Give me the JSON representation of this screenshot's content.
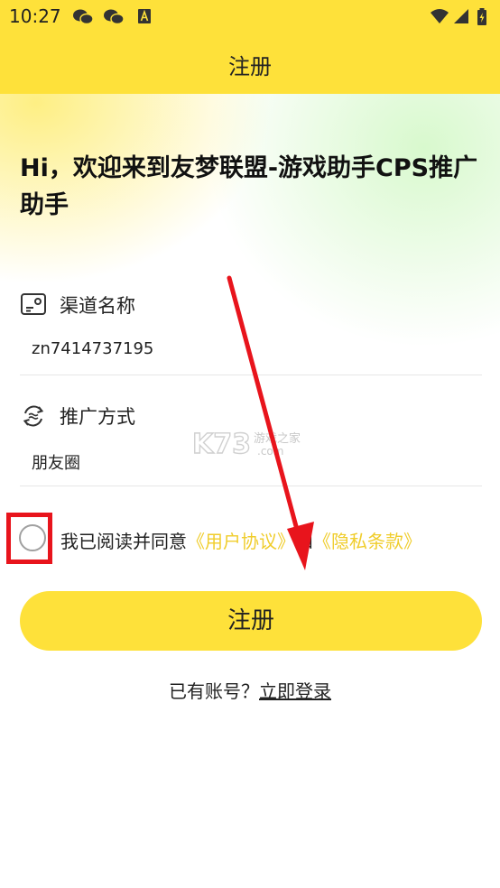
{
  "status_bar": {
    "time": "10:27",
    "left_icons": [
      "wechat-icon",
      "wechat-icon",
      "app-a-icon"
    ],
    "right_icons": [
      "wifi-icon",
      "signal-icon",
      "battery-charging-icon"
    ]
  },
  "header": {
    "title": "注册"
  },
  "welcome": {
    "text": "Hi，欢迎来到友梦联盟-游戏助手CPS推广助手"
  },
  "form": {
    "channel": {
      "label": "渠道名称",
      "value": "zn7414737195",
      "icon": "id-card-icon"
    },
    "method": {
      "label": "推广方式",
      "value": "朋友圈",
      "icon": "refresh-icon"
    }
  },
  "agreement": {
    "prefix": "我已阅读并同意",
    "user_agreement": "《用户协议》",
    "and": "和",
    "privacy": "《隐私条款》"
  },
  "register_button": {
    "label": "注册"
  },
  "login": {
    "prompt": "已有账号？",
    "link": "立即登录"
  },
  "colors": {
    "accent": "#fee13a",
    "link": "#f0cd2c",
    "annotation_red": "#e8141c"
  }
}
